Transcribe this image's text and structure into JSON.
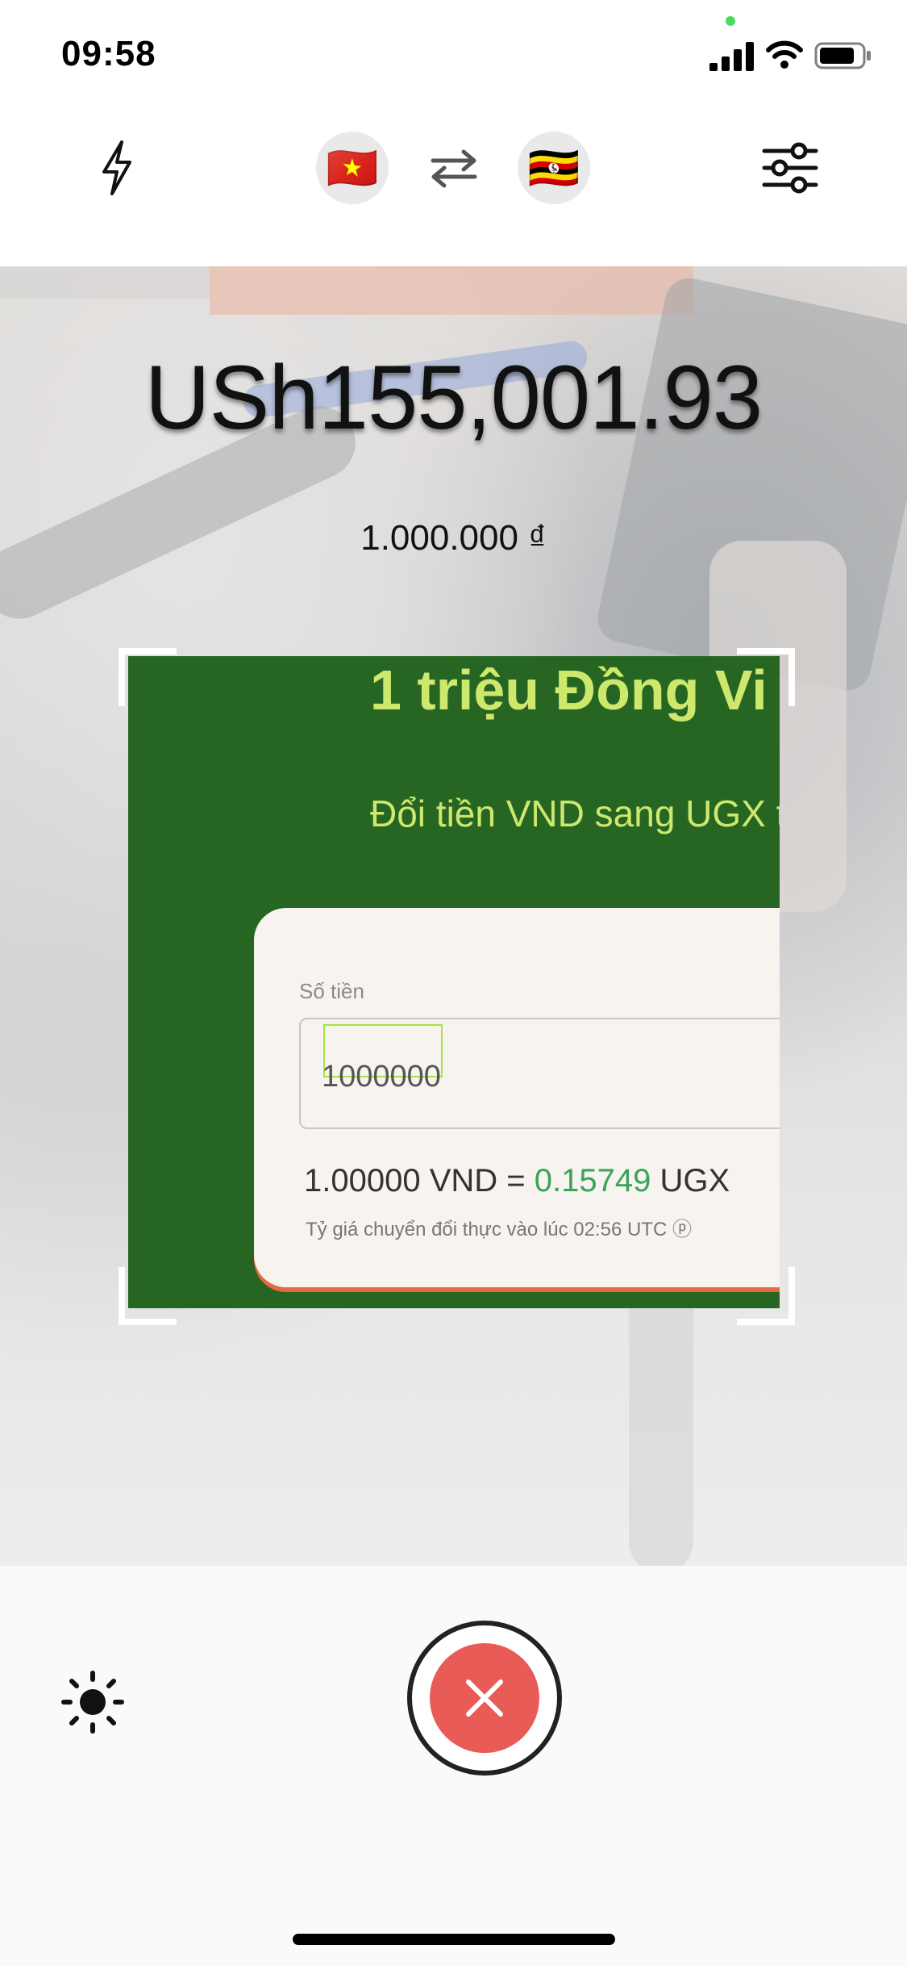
{
  "status_bar": {
    "time": "09:58"
  },
  "toolbar": {
    "flash_icon": "lightning-bolt-icon",
    "from_flag": "🇻🇳",
    "swap_icon": "swap-arrows-icon",
    "to_flag": "🇺🇬",
    "settings_icon": "sliders-icon"
  },
  "conversion": {
    "converted_amount": "USh155,001.93",
    "source_amount": "1.000.000 ₫"
  },
  "scanned_image": {
    "heading": "1 triệu Đồng Vi",
    "subheading": "Đổi tiền VND sang UGX t",
    "field_label": "Số tiền",
    "field_value": "1000000",
    "rate_prefix": "1.00000 VND = ",
    "rate_value": "0.15749",
    "rate_suffix": " UGX",
    "rate_note": "Tỷ giá chuyển đổi thực vào lúc 02:56 UTC ⓟ"
  },
  "bottom": {
    "brightness_icon": "sun-icon",
    "close_icon": "close-x-icon"
  },
  "colors": {
    "accent_red": "#e85b56",
    "scan_green": "#276622",
    "highlight_green": "#a7e24a"
  }
}
